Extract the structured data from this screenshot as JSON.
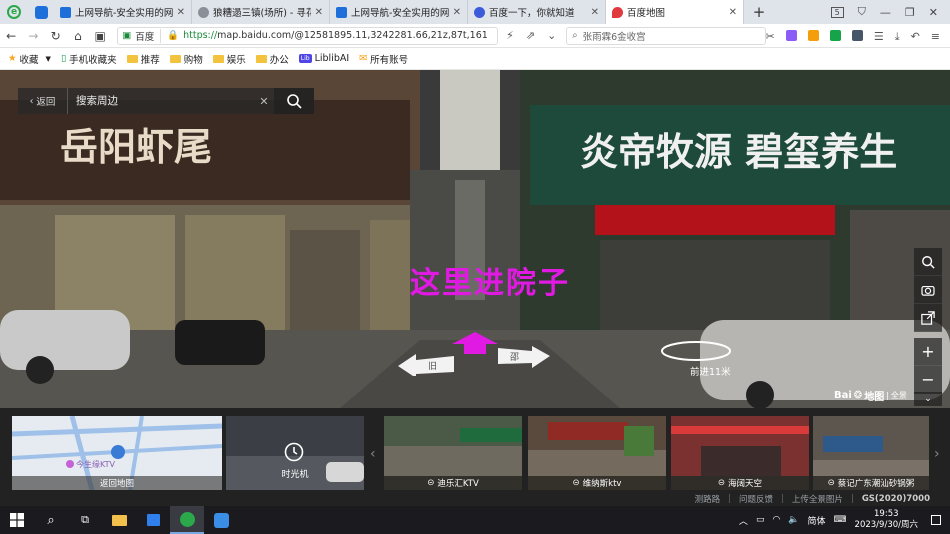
{
  "browser": {
    "logo_letter": "e",
    "tabs": [
      {
        "title": "上网导航-安全实用的网址",
        "color": "#1e6fd9",
        "active": false
      },
      {
        "title": "狼糟遢三镇(场所) - 寻花",
        "color": "#8a8f98",
        "active": false
      },
      {
        "title": "上网导航-安全实用的网址",
        "color": "#1e6fd9",
        "active": false
      },
      {
        "title": "百度一下，你就知道",
        "color": "#3b5bdb",
        "active": false
      },
      {
        "title": "百度地图",
        "color": "#e0393e",
        "active": true
      }
    ],
    "new_tab": "+",
    "window_badge": "5"
  },
  "address_bar": {
    "site_label": "百度",
    "scheme": "https://",
    "url_rest": "map.baidu.com/@12581895.11,3242281.66,21z,87t,161",
    "search_value": "张雨霖6金收宫"
  },
  "bookmarks": [
    {
      "label": "收藏",
      "icon": "star-icon"
    },
    {
      "label": "手机收藏夹",
      "icon": "phone-icon"
    },
    {
      "label": "推荐",
      "icon": "folder-icon"
    },
    {
      "label": "购物",
      "icon": "folder-icon"
    },
    {
      "label": "娱乐",
      "icon": "folder-icon"
    },
    {
      "label": "办公",
      "icon": "folder-icon"
    },
    {
      "label": "LiblibAI",
      "icon": "lib-icon"
    },
    {
      "label": "所有账号",
      "icon": "account-icon"
    }
  ],
  "streetview": {
    "back_label": "返回",
    "search_placeholder": "搜索周边",
    "annotation": "这里进院子",
    "forward_label": "前进11米",
    "arrow_left_label": "旧",
    "arrow_right_label": "邵",
    "logo_text": "Bai",
    "logo_suffix": "地图",
    "logo_small": "全景"
  },
  "thumbnails": {
    "map_label": "返回地图",
    "map_place": "今生缘KTV",
    "time_label": "时光机",
    "panoramas": [
      {
        "label": "迪乐汇KTV"
      },
      {
        "label": "维纳斯ktv"
      },
      {
        "label": "海阔天空"
      },
      {
        "label": "蔡记广东潮汕砂锅粥"
      }
    ]
  },
  "footer": {
    "links": [
      "测路路",
      "问题反馈",
      "上传全景图片"
    ],
    "license": "GS(2020)7000"
  },
  "taskbar": {
    "time": "19:53",
    "date": "2023/9/30/周六",
    "ime": "简体"
  }
}
